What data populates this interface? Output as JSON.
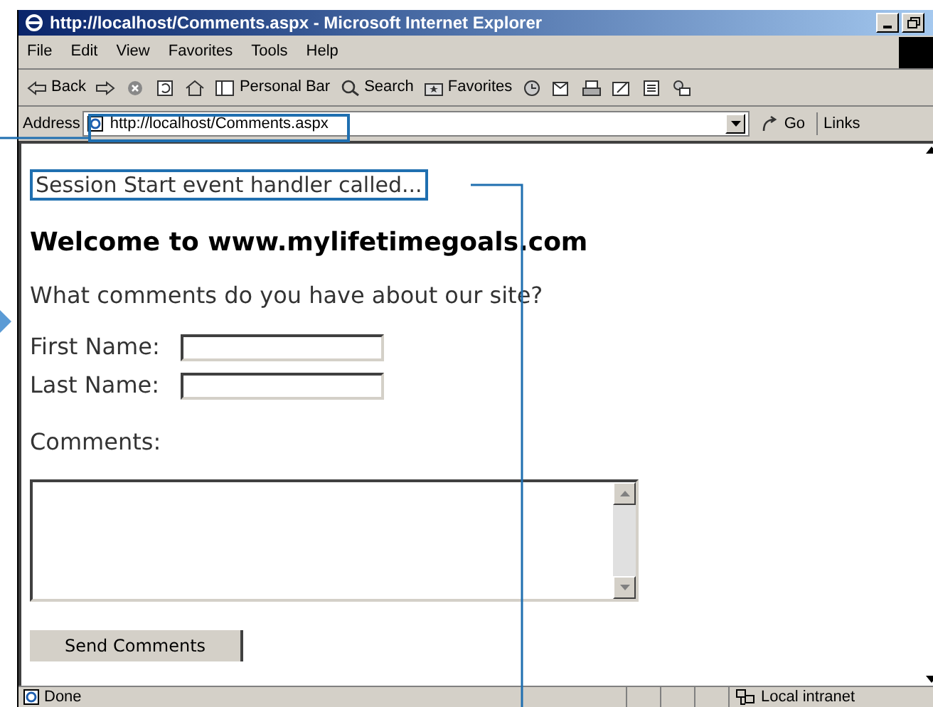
{
  "window": {
    "title": "http://localhost/Comments.aspx - Microsoft Internet Explorer"
  },
  "menu": [
    "File",
    "Edit",
    "View",
    "Favorites",
    "Tools",
    "Help"
  ],
  "toolbar": [
    {
      "kind": "back",
      "label": "Back"
    },
    {
      "kind": "forward"
    },
    {
      "kind": "stop"
    },
    {
      "kind": "refresh"
    },
    {
      "kind": "home"
    },
    {
      "kind": "personal",
      "label": "Personal Bar"
    },
    {
      "kind": "search",
      "label": "Search"
    },
    {
      "kind": "favorites",
      "label": "Favorites"
    },
    {
      "kind": "history"
    },
    {
      "kind": "mail"
    },
    {
      "kind": "print"
    },
    {
      "kind": "edit"
    },
    {
      "kind": "discuss"
    },
    {
      "kind": "messenger"
    }
  ],
  "address": {
    "label": "Address",
    "value": "http://localhost/Comments.aspx",
    "go": "Go",
    "links": "Links"
  },
  "page": {
    "session_message": "Session Start event handler called...",
    "heading": "Welcome to www.mylifetimegoals.com",
    "question": "What comments do you have about our site?",
    "fields": [
      {
        "label": "First Name:"
      },
      {
        "label": "Last Name:"
      }
    ],
    "comments_label": "Comments:",
    "button": "Send Comments"
  },
  "status_bar": {
    "text": "Done",
    "zone": "Local intranet"
  }
}
